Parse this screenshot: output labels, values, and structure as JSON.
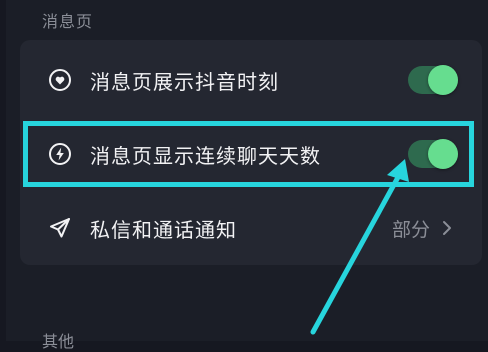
{
  "section_message": {
    "title": "消息页",
    "items": [
      {
        "label": "消息页展示抖音时刻",
        "icon": "heart-circle-icon",
        "toggle_on": true
      },
      {
        "label": "消息页显示连续聊天天数",
        "icon": "lightning-circle-icon",
        "toggle_on": true
      },
      {
        "label": "私信和通话通知",
        "icon": "send-icon",
        "value": "部分"
      }
    ]
  },
  "section_other": {
    "title": "其他"
  },
  "colors": {
    "background": "#1b1e27",
    "card": "#242731",
    "toggle_track": "#2e6a4e",
    "toggle_knob": "#66dd8f",
    "annotation": "#27d5dd"
  }
}
